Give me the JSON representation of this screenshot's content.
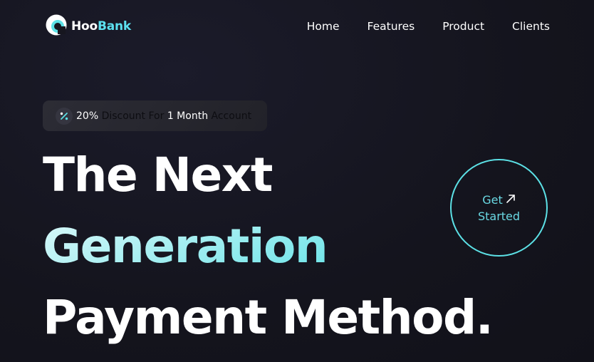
{
  "brand": {
    "name_part1": "Hoo",
    "name_part2": "Bank",
    "icon": "hoobank-logo-icon",
    "accent_color": "#5ce1e6"
  },
  "nav": {
    "items": [
      {
        "label": "Home"
      },
      {
        "label": "Features"
      },
      {
        "label": "Product"
      },
      {
        "label": "Clients"
      }
    ]
  },
  "promo": {
    "icon": "discount-icon",
    "percent": "20%",
    "text1": "Discount For",
    "duration": "1 Month",
    "text2": "Account"
  },
  "hero": {
    "line1": "The Next",
    "line2": "Generation",
    "line3": "Payment Method."
  },
  "cta": {
    "line1": "Get",
    "line2": "Started",
    "icon": "arrow-up-right-icon"
  }
}
